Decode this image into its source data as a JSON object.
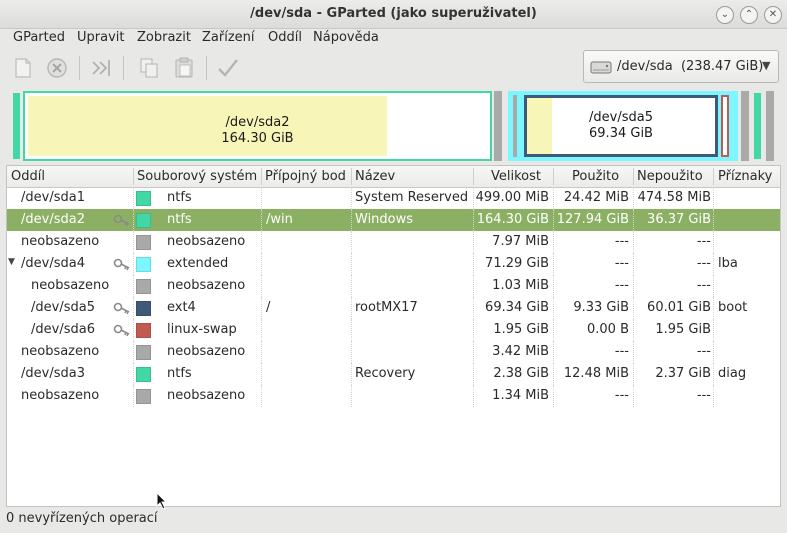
{
  "window": {
    "title": "/dev/sda - GParted (jako superuživatel)"
  },
  "menu": [
    "GParted",
    "Upravit",
    "Zobrazit",
    "Zařízení",
    "Oddíl",
    "Nápověda"
  ],
  "toolbar": {
    "icons": [
      "new-icon",
      "delete-icon",
      "resize-move-icon",
      "copy-icon",
      "paste-icon",
      "apply-icon"
    ]
  },
  "device_selector": {
    "label": "/dev/sda  (238.47 GiB)",
    "icon": "harddisk-icon"
  },
  "partition_map": {
    "sda2": {
      "name": "/dev/sda2",
      "size": "164.30 GiB"
    },
    "sda5": {
      "name": "/dev/sda5",
      "size": "69.34 GiB"
    }
  },
  "table": {
    "columns": [
      "Oddíl",
      "Souborový systém",
      "Přípojný bod",
      "Název",
      "Velikost",
      "Použito",
      "Nepoužito",
      "Příznaky"
    ],
    "rows": [
      {
        "partition": "/dev/sda1",
        "fs": "ntfs",
        "mount": "",
        "label": "System Reserved",
        "size": "499.00 MiB",
        "used": "24.42 MiB",
        "unused": "474.58 MiB",
        "flags": "",
        "color": "#42d7a7",
        "key": false,
        "indent": 0,
        "expander": "",
        "selected": false
      },
      {
        "partition": "/dev/sda2",
        "fs": "ntfs",
        "mount": "/win",
        "label": "Windows",
        "size": "164.30 GiB",
        "used": "127.94 GiB",
        "unused": "36.37 GiB",
        "flags": "",
        "color": "#42d7a7",
        "key": true,
        "indent": 0,
        "expander": "",
        "selected": true
      },
      {
        "partition": "neobsazeno",
        "fs": "neobsazeno",
        "mount": "",
        "label": "",
        "size": "7.97 MiB",
        "used": "---",
        "unused": "---",
        "flags": "",
        "color": "#a9a9a9",
        "key": false,
        "indent": 0,
        "expander": "",
        "selected": false
      },
      {
        "partition": "/dev/sda4",
        "fs": "extended",
        "mount": "",
        "label": "",
        "size": "71.29 GiB",
        "used": "---",
        "unused": "---",
        "flags": "lba",
        "color": "#7df7ff",
        "key": true,
        "indent": 0,
        "expander": "▼",
        "selected": false
      },
      {
        "partition": "neobsazeno",
        "fs": "neobsazeno",
        "mount": "",
        "label": "",
        "size": "1.03 MiB",
        "used": "---",
        "unused": "---",
        "flags": "",
        "color": "#a9a9a9",
        "key": false,
        "indent": 1,
        "expander": "",
        "selected": false
      },
      {
        "partition": "/dev/sda5",
        "fs": "ext4",
        "mount": "/",
        "label": "rootMX17",
        "size": "69.34 GiB",
        "used": "9.33 GiB",
        "unused": "60.01 GiB",
        "flags": "boot",
        "color": "#3f5a78",
        "key": true,
        "indent": 1,
        "expander": "",
        "selected": false
      },
      {
        "partition": "/dev/sda6",
        "fs": "linux-swap",
        "mount": "",
        "label": "",
        "size": "1.95 GiB",
        "used": "0.00 B",
        "unused": "1.95 GiB",
        "flags": "",
        "color": "#c25a4f",
        "key": true,
        "indent": 1,
        "expander": "",
        "selected": false
      },
      {
        "partition": "neobsazeno",
        "fs": "neobsazeno",
        "mount": "",
        "label": "",
        "size": "3.42 MiB",
        "used": "---",
        "unused": "---",
        "flags": "",
        "color": "#a9a9a9",
        "key": false,
        "indent": 0,
        "expander": "",
        "selected": false
      },
      {
        "partition": "/dev/sda3",
        "fs": "ntfs",
        "mount": "",
        "label": "Recovery",
        "size": "2.38 GiB",
        "used": "12.48 MiB",
        "unused": "2.37 GiB",
        "flags": "diag",
        "color": "#42d7a7",
        "key": false,
        "indent": 0,
        "expander": "",
        "selected": false
      },
      {
        "partition": "neobsazeno",
        "fs": "neobsazeno",
        "mount": "",
        "label": "",
        "size": "1.34 MiB",
        "used": "---",
        "unused": "---",
        "flags": "",
        "color": "#a9a9a9",
        "key": false,
        "indent": 0,
        "expander": "",
        "selected": false
      }
    ]
  },
  "status": {
    "text": "0 nevyřízených operací"
  }
}
